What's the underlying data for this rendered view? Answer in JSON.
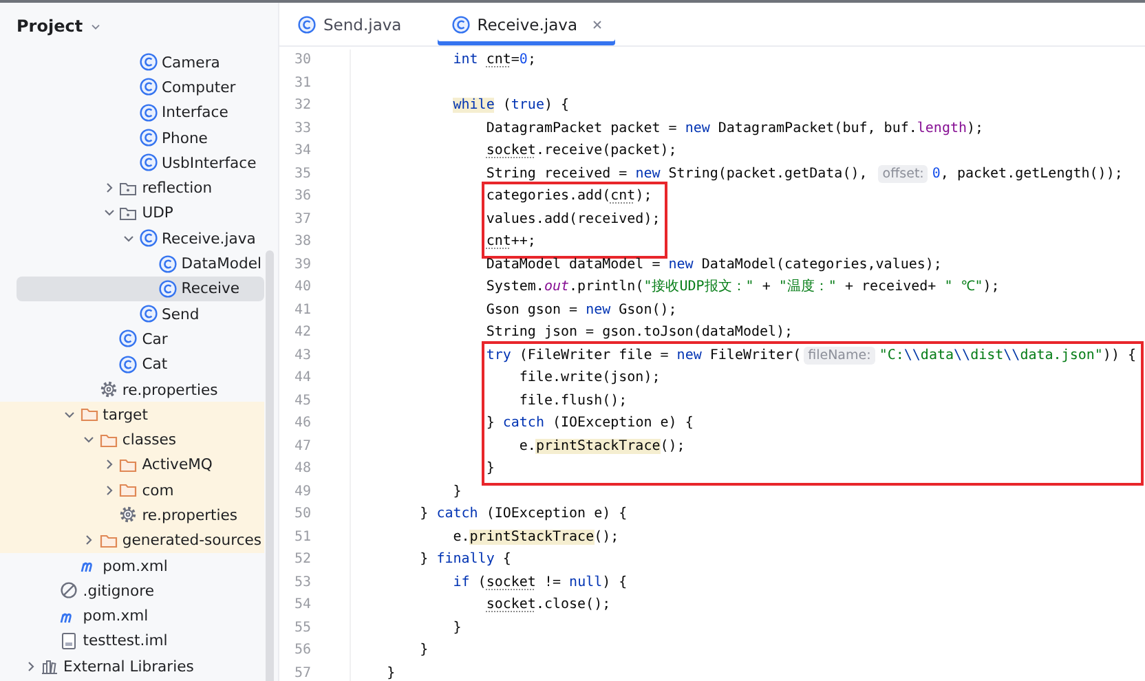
{
  "sidebar": {
    "title": "Project",
    "tree": [
      {
        "kind": "hidden",
        "children": [
          {
            "kind": "hidden",
            "children": [
              {
                "kind": "hidden",
                "children": [
                  {
                    "kind": "hidden",
                    "children": [
                      {
                        "kind": "hidden",
                        "children": [
                          {
                            "kind": "class",
                            "label": "Camera",
                            "selected": false
                          },
                          {
                            "kind": "class",
                            "label": "Computer",
                            "selected": false
                          },
                          {
                            "kind": "class",
                            "label": "Interface",
                            "selected": false
                          },
                          {
                            "kind": "class",
                            "label": "Phone",
                            "selected": false
                          },
                          {
                            "kind": "class",
                            "label": "UsbInterface",
                            "selected": false
                          }
                        ]
                      },
                      {
                        "kind": "package",
                        "label": "reflection",
                        "selected": false,
                        "expanded": false
                      },
                      {
                        "kind": "package",
                        "label": "UDP",
                        "selected": false,
                        "expanded": true,
                        "children": [
                          {
                            "kind": "class",
                            "label": "Receive.java",
                            "selected": false,
                            "expanded": true,
                            "children": [
                              {
                                "kind": "class",
                                "label": "DataModel",
                                "selected": false
                              },
                              {
                                "kind": "class",
                                "label": "Receive",
                                "selected": true
                              }
                            ]
                          },
                          {
                            "kind": "class",
                            "label": "Send",
                            "selected": false
                          }
                        ]
                      },
                      {
                        "kind": "class",
                        "label": "Car",
                        "selected": false
                      },
                      {
                        "kind": "class",
                        "label": "Cat",
                        "selected": false
                      }
                    ]
                  },
                  {
                    "kind": "properties",
                    "label": "re.properties",
                    "selected": false
                  }
                ]
              },
              {
                "kind": "folder",
                "label": "target",
                "selected": false,
                "expanded": true,
                "excluded": true,
                "children": [
                  {
                    "kind": "folder",
                    "label": "classes",
                    "selected": false,
                    "expanded": true,
                    "children": [
                      {
                        "kind": "folder",
                        "label": "ActiveMQ",
                        "selected": false,
                        "expanded": false
                      },
                      {
                        "kind": "folder",
                        "label": "com",
                        "selected": false,
                        "expanded": false
                      },
                      {
                        "kind": "properties",
                        "label": "re.properties",
                        "selected": false
                      }
                    ]
                  },
                  {
                    "kind": "folder",
                    "label": "generated-sources",
                    "selected": false,
                    "expanded": false
                  }
                ]
              },
              {
                "kind": "maven",
                "label": "pom.xml",
                "selected": false
              }
            ]
          },
          {
            "kind": "gitignore",
            "label": ".gitignore",
            "selected": false
          },
          {
            "kind": "maven",
            "label": "pom.xml",
            "selected": false
          },
          {
            "kind": "iml",
            "label": "testtest.iml",
            "selected": false
          }
        ]
      },
      {
        "kind": "library",
        "label": "External Libraries",
        "selected": false,
        "expanded": false
      }
    ]
  },
  "tabs": [
    {
      "label": "Send.java",
      "selected": false,
      "closable": false
    },
    {
      "label": "Receive.java",
      "selected": true,
      "closable": true
    }
  ],
  "editor": {
    "lines": [
      {
        "kind": "block",
        "lines": [
          {
            "kind": "block",
            "lines": [
              {
                "kind": "block",
                "lines": [
                  {
                    "kind": "line",
                    "n": "30",
                    "code": [
                      {
                        "kind": "keyword",
                        "text": "int "
                      },
                      {
                        "kind": "underlined",
                        "text": "cnt"
                      },
                      "=",
                      {
                        "kind": "number",
                        "text": "0"
                      },
                      ";"
                    ]
                  },
                  {
                    "kind": "line",
                    "n": "31"
                  },
                  {
                    "kind": "line",
                    "n": "32",
                    "code": [
                      {
                        "kind": "keyword-highlighted",
                        "text": "while"
                      },
                      " (",
                      {
                        "kind": "keyword",
                        "text": "true"
                      },
                      ") {"
                    ]
                  },
                  {
                    "kind": "block",
                    "lines": [
                      {
                        "kind": "line",
                        "n": "33",
                        "code": [
                          "DatagramPacket packet = ",
                          {
                            "kind": "keyword",
                            "text": "new"
                          },
                          " DatagramPacket(buf, buf.",
                          {
                            "kind": "field",
                            "text": "length"
                          },
                          ");"
                        ]
                      },
                      {
                        "kind": "line",
                        "n": "34",
                        "code": [
                          {
                            "kind": "underlined",
                            "text": "socket"
                          },
                          ".receive(packet);"
                        ]
                      },
                      {
                        "kind": "line",
                        "n": "35",
                        "code": [
                          "String received = ",
                          {
                            "kind": "keyword",
                            "text": "new"
                          },
                          " String(packet.getData(), ",
                          {
                            "kind": "hint",
                            "text": "offset:"
                          },
                          {
                            "kind": "number",
                            "text": "0"
                          },
                          ", packet.getLength());"
                        ]
                      },
                      {
                        "kind": "boxed",
                        "lines": [
                          {
                            "kind": "line",
                            "n": "36",
                            "code": [
                              "categories.add(",
                              {
                                "kind": "underlined",
                                "text": "cnt"
                              },
                              ");"
                            ]
                          },
                          {
                            "kind": "line",
                            "n": "37",
                            "code": [
                              "values.add(received);"
                            ]
                          },
                          {
                            "kind": "line",
                            "n": "38",
                            "code": [
                              {
                                "kind": "underlined",
                                "text": "cnt"
                              },
                              "++;"
                            ]
                          }
                        ]
                      },
                      {
                        "kind": "line",
                        "n": "39",
                        "code": [
                          "DataModel dataModel = ",
                          {
                            "kind": "keyword",
                            "text": "new"
                          },
                          " DataModel(categories,values);"
                        ]
                      },
                      {
                        "kind": "line",
                        "n": "40",
                        "code": [
                          "System.",
                          {
                            "kind": "static-field",
                            "text": "out"
                          },
                          ".println(",
                          {
                            "kind": "string",
                            "text": "\"接收UDP报文：\""
                          },
                          " + ",
                          {
                            "kind": "string",
                            "text": "\"温度：\""
                          },
                          " + received+ ",
                          {
                            "kind": "string",
                            "text": "\" ℃\""
                          },
                          ");"
                        ]
                      },
                      {
                        "kind": "line",
                        "n": "41",
                        "code": [
                          "Gson gson = ",
                          {
                            "kind": "keyword",
                            "text": "new"
                          },
                          " Gson();"
                        ]
                      },
                      {
                        "kind": "line",
                        "n": "42",
                        "code": [
                          "String json = gson.toJson(dataModel);"
                        ]
                      },
                      {
                        "kind": "boxed",
                        "lines": [
                          {
                            "kind": "line",
                            "n": "43",
                            "code": [
                              {
                                "kind": "keyword",
                                "text": "try"
                              },
                              " (FileWriter file = ",
                              {
                                "kind": "keyword",
                                "text": "new"
                              },
                              " FileWriter(",
                              {
                                "kind": "hint",
                                "text": "fileName:"
                              },
                              {
                                "kind": "string",
                                "text": "\"C:"
                              },
                              {
                                "kind": "escape",
                                "text": "\\\\"
                              },
                              {
                                "kind": "string",
                                "text": "data"
                              },
                              {
                                "kind": "escape",
                                "text": "\\\\"
                              },
                              {
                                "kind": "string",
                                "text": "dist"
                              },
                              {
                                "kind": "escape",
                                "text": "\\\\"
                              },
                              {
                                "kind": "string",
                                "text": "data.json\""
                              },
                              ")) {"
                            ]
                          },
                          {
                            "kind": "block",
                            "lines": [
                              {
                                "kind": "line",
                                "n": "44",
                                "code": [
                                  "file.write(json);"
                                ]
                              },
                              {
                                "kind": "line",
                                "n": "45",
                                "code": [
                                  "file.flush();"
                                ]
                              }
                            ]
                          },
                          {
                            "kind": "line",
                            "n": "46",
                            "code": [
                              "} ",
                              {
                                "kind": "keyword",
                                "text": "catch"
                              },
                              " (IOException e) {"
                            ]
                          },
                          {
                            "kind": "block",
                            "lines": [
                              {
                                "kind": "line",
                                "n": "47",
                                "code": [
                                  "e.",
                                  {
                                    "kind": "highlighted",
                                    "text": "printStackTrace"
                                  },
                                  "();"
                                ]
                              }
                            ]
                          },
                          {
                            "kind": "line",
                            "n": "48",
                            "code": [
                              "}"
                            ]
                          }
                        ]
                      }
                    ]
                  },
                  {
                    "kind": "line",
                    "n": "49",
                    "code": [
                      "}"
                    ]
                  }
                ]
              },
              {
                "kind": "line",
                "n": "50",
                "code": [
                  "} ",
                  {
                    "kind": "keyword",
                    "text": "catch"
                  },
                  " (IOException e) {"
                ]
              },
              {
                "kind": "block",
                "lines": [
                  {
                    "kind": "line",
                    "n": "51",
                    "code": [
                      "e.",
                      {
                        "kind": "highlighted",
                        "text": "printStackTrace"
                      },
                      "();"
                    ]
                  }
                ]
              },
              {
                "kind": "line",
                "n": "52",
                "code": [
                  "} ",
                  {
                    "kind": "keyword",
                    "text": "finally"
                  },
                  " {"
                ]
              },
              {
                "kind": "block",
                "lines": [
                  {
                    "kind": "line",
                    "n": "53",
                    "code": [
                      {
                        "kind": "keyword",
                        "text": "if"
                      },
                      " (",
                      {
                        "kind": "underlined",
                        "text": "socket"
                      },
                      " != ",
                      {
                        "kind": "keyword",
                        "text": "null"
                      },
                      ") {"
                    ]
                  },
                  {
                    "kind": "block",
                    "lines": [
                      {
                        "kind": "line",
                        "n": "54",
                        "code": [
                          {
                            "kind": "underlined",
                            "text": "socket"
                          },
                          ".close();"
                        ]
                      }
                    ]
                  },
                  {
                    "kind": "line",
                    "n": "55",
                    "code": [
                      "}"
                    ]
                  }
                ]
              },
              {
                "kind": "line",
                "n": "56",
                "code": [
                  "}"
                ]
              }
            ]
          },
          {
            "kind": "line",
            "n": "57",
            "code": [
              "}"
            ]
          }
        ]
      }
    ]
  }
}
